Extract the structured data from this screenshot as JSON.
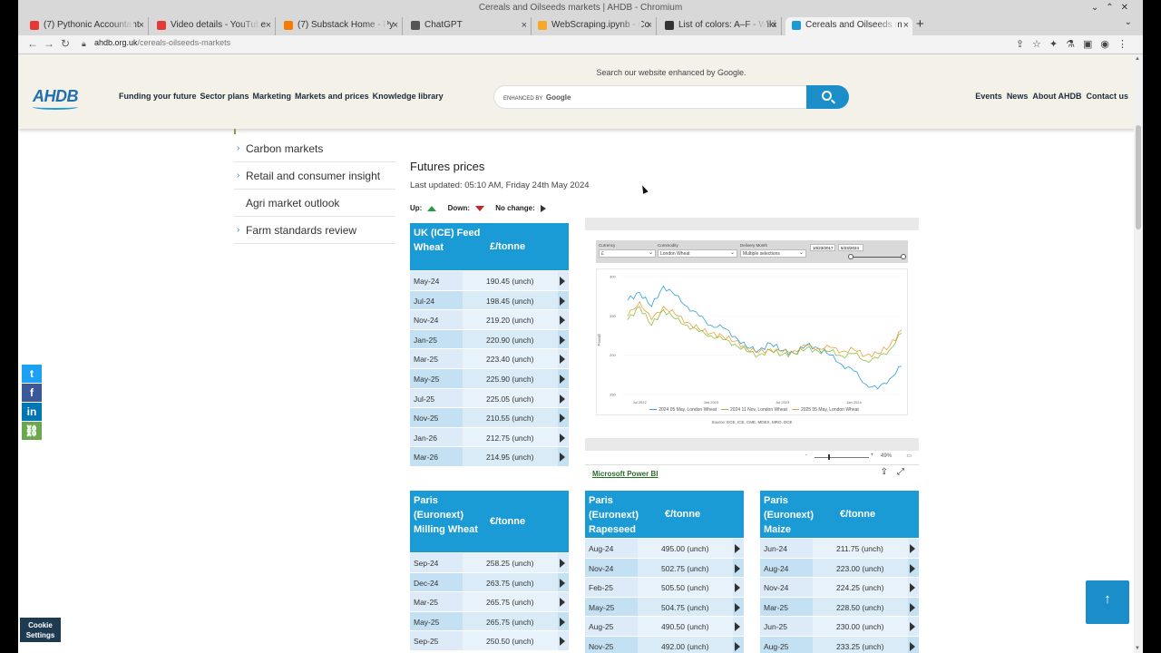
{
  "window": {
    "title": "Cereals and Oilseeds markets | AHDB - Chromium"
  },
  "tabs": [
    {
      "label": "(7) Pythonic Accountant",
      "color": "#e53935"
    },
    {
      "label": "Video details - YouTube",
      "color": "#e53935"
    },
    {
      "label": "(7) Substack Home - Py",
      "color": "#f57c00"
    },
    {
      "label": "ChatGPT",
      "color": "#555555"
    },
    {
      "label": "WebScraping.ipynb - Co",
      "color": "#f9a825"
    },
    {
      "label": "List of colors: A–F - Wiki",
      "color": "#333333"
    },
    {
      "label": "Cereals and Oilseeds m",
      "color": "#1b9bd6"
    }
  ],
  "address": {
    "host": "ahdb.org.uk",
    "path": "/cereals-oilseeds-markets"
  },
  "header": {
    "logo": "AHDB",
    "nav": [
      "Funding your future",
      "Sector plans",
      "Marketing",
      "Markets and prices",
      "Knowledge library"
    ],
    "search_caption": "Search our website enhanced by Google.",
    "search_enhanced": "ENHANCED BY",
    "search_google": "Google",
    "util_nav": [
      "Events",
      "News",
      "About AHDB",
      "Contact us"
    ]
  },
  "sidebar": [
    {
      "label": "Carbon markets",
      "chevron": true
    },
    {
      "label": "Retail and consumer insight",
      "chevron": true
    },
    {
      "label": "Agri market outlook",
      "chevron": false
    },
    {
      "label": "Farm standards review",
      "chevron": true
    }
  ],
  "futures": {
    "title": "Futures prices",
    "updated": "Last updated: 05:10 AM, Friday 24th May 2024",
    "legend_up": "Up:",
    "legend_down": "Down:",
    "legend_nochange": "No change:"
  },
  "tables": {
    "uk_feed_wheat": {
      "name": "UK (ICE) Feed Wheat",
      "unit": "£/tonne",
      "rows": [
        {
          "month": "May-24",
          "value": "190.45 (unch)"
        },
        {
          "month": "Jul-24",
          "value": "198.45 (unch)"
        },
        {
          "month": "Nov-24",
          "value": "219.20 (unch)"
        },
        {
          "month": "Jan-25",
          "value": "220.90 (unch)"
        },
        {
          "month": "Mar-25",
          "value": "223.40 (unch)"
        },
        {
          "month": "May-25",
          "value": "225.90 (unch)"
        },
        {
          "month": "Jul-25",
          "value": "225.05 (unch)"
        },
        {
          "month": "Nov-25",
          "value": "210.55 (unch)"
        },
        {
          "month": "Jan-26",
          "value": "212.75 (unch)"
        },
        {
          "month": "Mar-26",
          "value": "214.95 (unch)"
        }
      ]
    },
    "paris_milling_wheat": {
      "name": "Paris (Euronext) Milling Wheat",
      "unit": "€/tonne",
      "rows": [
        {
          "month": "Sep-24",
          "value": "258.25 (unch)"
        },
        {
          "month": "Dec-24",
          "value": "263.75 (unch)"
        },
        {
          "month": "Mar-25",
          "value": "265.75 (unch)"
        },
        {
          "month": "May-25",
          "value": "265.75 (unch)"
        },
        {
          "month": "Sep-25",
          "value": "250.50 (unch)"
        }
      ]
    },
    "paris_rapeseed": {
      "name": "Paris (Euronext) Rapeseed",
      "unit": "€/tonne",
      "rows": [
        {
          "month": "Aug-24",
          "value": "495.00 (unch)"
        },
        {
          "month": "Nov-24",
          "value": "502.75 (unch)"
        },
        {
          "month": "Feb-25",
          "value": "505.50 (unch)"
        },
        {
          "month": "May-25",
          "value": "504.75 (unch)"
        },
        {
          "month": "Aug-25",
          "value": "490.50 (unch)"
        },
        {
          "month": "Nov-25",
          "value": "492.00 (unch)"
        }
      ]
    },
    "paris_maize": {
      "name": "Paris (Euronext) Maize",
      "unit": "€/tonne",
      "rows": [
        {
          "month": "Jun-24",
          "value": "211.75 (unch)"
        },
        {
          "month": "Aug-24",
          "value": "223.00 (unch)"
        },
        {
          "month": "Nov-24",
          "value": "224.25 (unch)"
        },
        {
          "month": "Mar-25",
          "value": "228.50 (unch)"
        },
        {
          "month": "Jun-25",
          "value": "230.00 (unch)"
        },
        {
          "month": "Aug-25",
          "value": "233.25 (unch)"
        }
      ]
    }
  },
  "powerbi": {
    "filters": [
      {
        "label": "Currency",
        "value": "£"
      },
      {
        "label": "Commodity",
        "value": "London Wheat"
      },
      {
        "label": "Delivery Month",
        "value": "Multiple selections"
      }
    ],
    "date_from": "10/23/2017",
    "date_to": "5/23/2024",
    "zoom": "49%",
    "link": "Microsoft Power BI",
    "source": "Source: ECE, ICE, CME, MDEX, MRO, DCE"
  },
  "chart_data": {
    "type": "line",
    "ylabel": "Pound",
    "ylim": [
      150,
      300
    ],
    "yticks": [
      150,
      200,
      250,
      300
    ],
    "xticks": [
      "Jul 2022",
      "Jan 2023",
      "Jul 2023",
      "Jan 2024"
    ],
    "x": [
      "2022-06",
      "2022-07",
      "2022-08",
      "2022-09",
      "2022-10",
      "2022-11",
      "2022-12",
      "2023-01",
      "2023-02",
      "2023-03",
      "2023-04",
      "2023-05",
      "2023-06",
      "2023-07",
      "2023-08",
      "2023-09",
      "2023-10",
      "2023-11",
      "2023-12",
      "2024-01",
      "2024-02",
      "2024-03",
      "2024-04",
      "2024-05"
    ],
    "series": [
      {
        "name": "2024 05 May, London Wheat",
        "color": "#2a9fd6",
        "values": [
          270,
          280,
          262,
          288,
          276,
          262,
          250,
          238,
          235,
          224,
          210,
          206,
          215,
          206,
          202,
          213,
          209,
          200,
          188,
          180,
          163,
          157,
          170,
          186
        ]
      },
      {
        "name": "2024 11 Nov, London Wheat",
        "color": "#8fbf3c",
        "values": [
          245,
          262,
          238,
          258,
          246,
          238,
          230,
          225,
          220,
          214,
          205,
          200,
          206,
          201,
          202,
          209,
          205,
          205,
          199,
          202,
          193,
          196,
          207,
          228
        ]
      },
      {
        "name": "2025 05 May, London Wheat",
        "color": "#e6a23c",
        "values": [
          250,
          268,
          245,
          262,
          252,
          242,
          233,
          228,
          224,
          218,
          209,
          203,
          208,
          204,
          206,
          212,
          209,
          210,
          205,
          207,
          200,
          202,
          212,
          232
        ]
      }
    ]
  },
  "share": [
    {
      "icon": "twitter-icon",
      "glyph": "t",
      "color": "#1da1f2"
    },
    {
      "icon": "facebook-icon",
      "glyph": "f",
      "color": "#3b5998"
    },
    {
      "icon": "linkedin-icon",
      "glyph": "in",
      "color": "#0077b5"
    },
    {
      "icon": "copy-link-icon",
      "glyph": "⛓",
      "color": "#6aa84f"
    }
  ],
  "cookie": {
    "label": "Cookie Settings"
  }
}
